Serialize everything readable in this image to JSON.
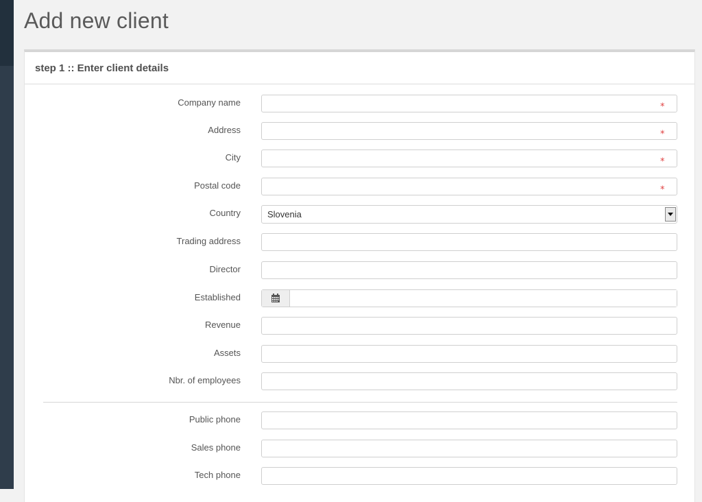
{
  "page": {
    "title": "Add new client"
  },
  "panel": {
    "heading": "step 1 :: Enter client details"
  },
  "required_symbol": "⁎",
  "colors": {
    "accent_required": "#e04343",
    "sidebar": "#2f3d4b",
    "title": "#5a5a5a"
  },
  "fields": {
    "company_name": {
      "label": "Company name",
      "value": "",
      "required": true
    },
    "address": {
      "label": "Address",
      "value": "",
      "required": true
    },
    "city": {
      "label": "City",
      "value": "",
      "required": true
    },
    "postal_code": {
      "label": "Postal code",
      "value": "",
      "required": true
    },
    "country": {
      "label": "Country",
      "value": "Slovenia"
    },
    "trading_address": {
      "label": "Trading address",
      "value": ""
    },
    "director": {
      "label": "Director",
      "value": ""
    },
    "established": {
      "label": "Established",
      "value": "",
      "icon": "calendar-icon"
    },
    "revenue": {
      "label": "Revenue",
      "value": ""
    },
    "assets": {
      "label": "Assets",
      "value": ""
    },
    "employees": {
      "label": "Nbr. of employees",
      "value": ""
    },
    "public_phone": {
      "label": "Public phone",
      "value": ""
    },
    "sales_phone": {
      "label": "Sales phone",
      "value": ""
    },
    "tech_phone": {
      "label": "Tech phone",
      "value": ""
    }
  }
}
